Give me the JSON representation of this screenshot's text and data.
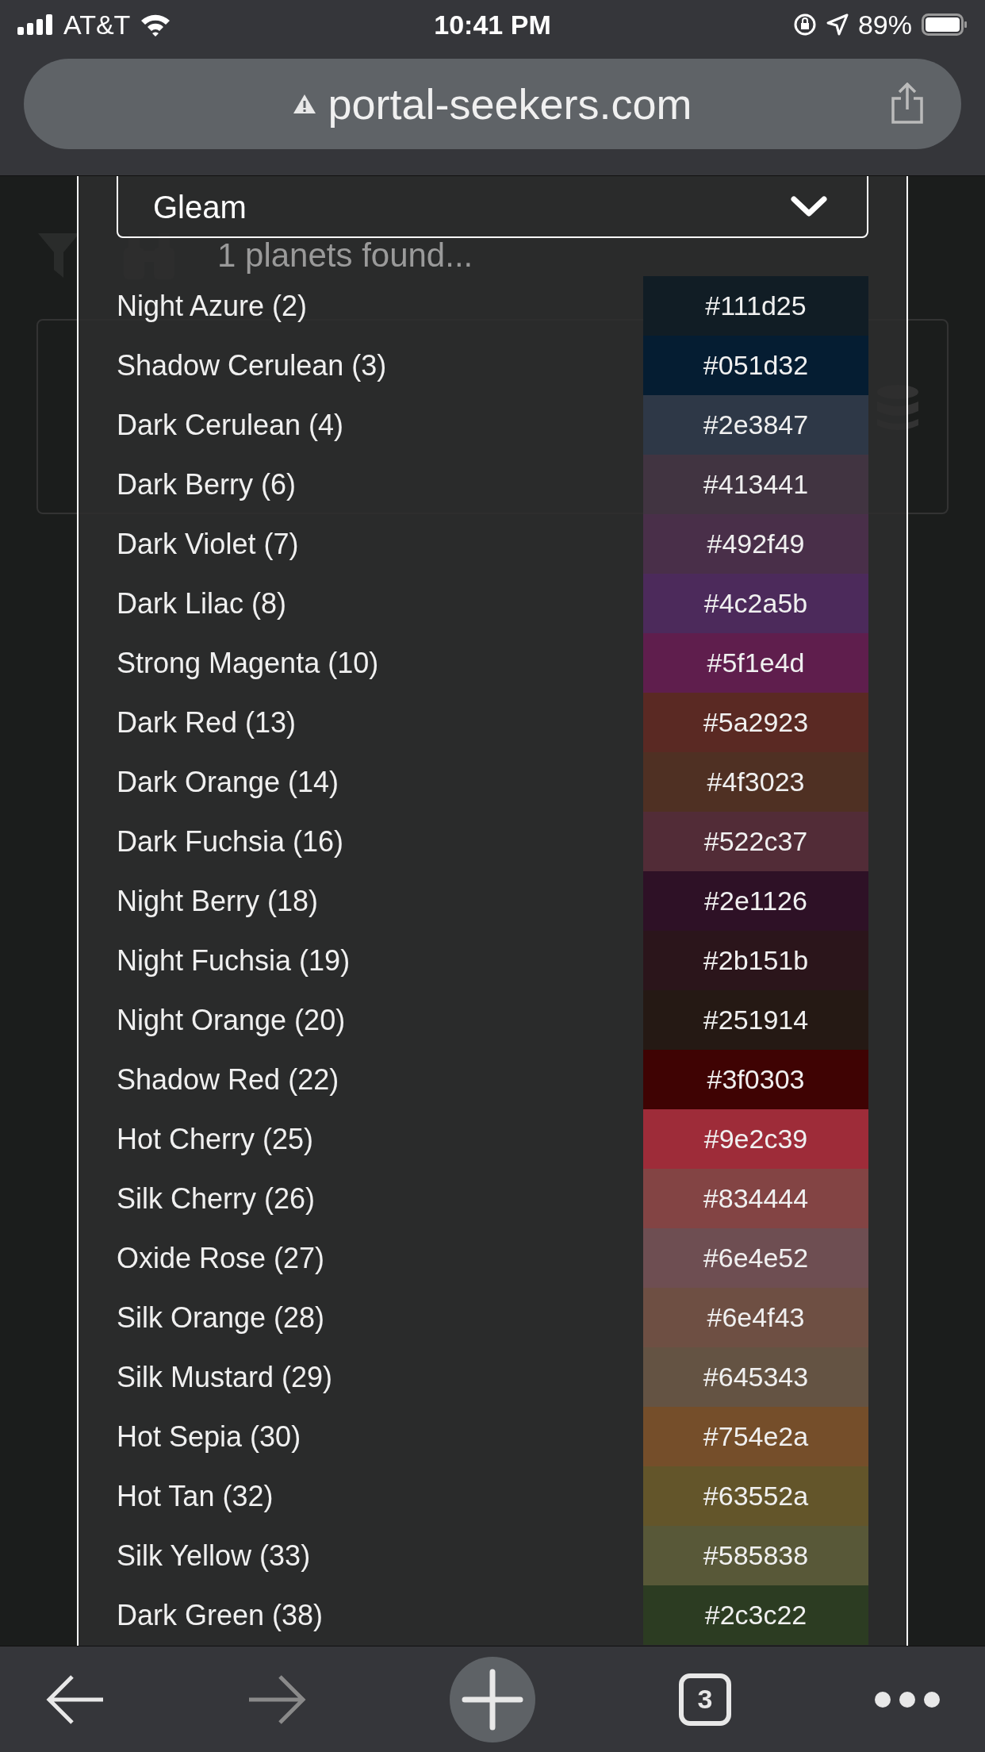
{
  "status_bar": {
    "carrier": "AT&T",
    "time": "10:41 PM",
    "battery": "89%"
  },
  "address_bar": {
    "url": "portal-seekers.com"
  },
  "background_page": {
    "result_text": "1 planets found..."
  },
  "color_picker": {
    "dropdown_value": "Gleam",
    "colors": [
      {
        "name": "Night Azure (2)",
        "hex": "#111d25",
        "color": "#111d25"
      },
      {
        "name": "Shadow Cerulean (3)",
        "hex": "#051d32",
        "color": "#051d32"
      },
      {
        "name": "Dark Cerulean (4)",
        "hex": "#2e3847",
        "color": "#2e3847"
      },
      {
        "name": "Dark Berry (6)",
        "hex": "#413441",
        "color": "#413441"
      },
      {
        "name": "Dark Violet (7)",
        "hex": "#492f49",
        "color": "#492f49"
      },
      {
        "name": "Dark Lilac (8)",
        "hex": "#4c2a5b",
        "color": "#4c2a5b"
      },
      {
        "name": "Strong Magenta (10)",
        "hex": "#5f1e4d",
        "color": "#5f1e4d"
      },
      {
        "name": "Dark Red (13)",
        "hex": "#5a2923",
        "color": "#5a2923"
      },
      {
        "name": "Dark Orange (14)",
        "hex": "#4f3023",
        "color": "#4f3023"
      },
      {
        "name": "Dark Fuchsia (16)",
        "hex": "#522c37",
        "color": "#522c37"
      },
      {
        "name": "Night Berry (18)",
        "hex": "#2e1126",
        "color": "#2e1126"
      },
      {
        "name": "Night Fuchsia (19)",
        "hex": "#2b151b",
        "color": "#2b151b"
      },
      {
        "name": "Night Orange (20)",
        "hex": "#251914",
        "color": "#251914"
      },
      {
        "name": "Shadow Red (22)",
        "hex": "#3f0303",
        "color": "#3f0303"
      },
      {
        "name": "Hot Cherry (25)",
        "hex": "#9e2c39",
        "color": "#9e2c39"
      },
      {
        "name": "Silk Cherry (26)",
        "hex": "#834444",
        "color": "#834444"
      },
      {
        "name": "Oxide Rose (27)",
        "hex": "#6e4e52",
        "color": "#6e4e52"
      },
      {
        "name": "Silk Orange (28)",
        "hex": "#6e4f43",
        "color": "#6e4f43"
      },
      {
        "name": "Silk Mustard (29)",
        "hex": "#645343",
        "color": "#645343"
      },
      {
        "name": "Hot Sepia (30)",
        "hex": "#754e2a",
        "color": "#754e2a"
      },
      {
        "name": "Hot Tan (32)",
        "hex": "#63552a",
        "color": "#63552a"
      },
      {
        "name": "Silk Yellow (33)",
        "hex": "#585838",
        "color": "#585838"
      },
      {
        "name": "Dark Green (38)",
        "hex": "#2c3c22",
        "color": "#2c3c22"
      }
    ]
  },
  "toolbar": {
    "tab_count": "3"
  }
}
